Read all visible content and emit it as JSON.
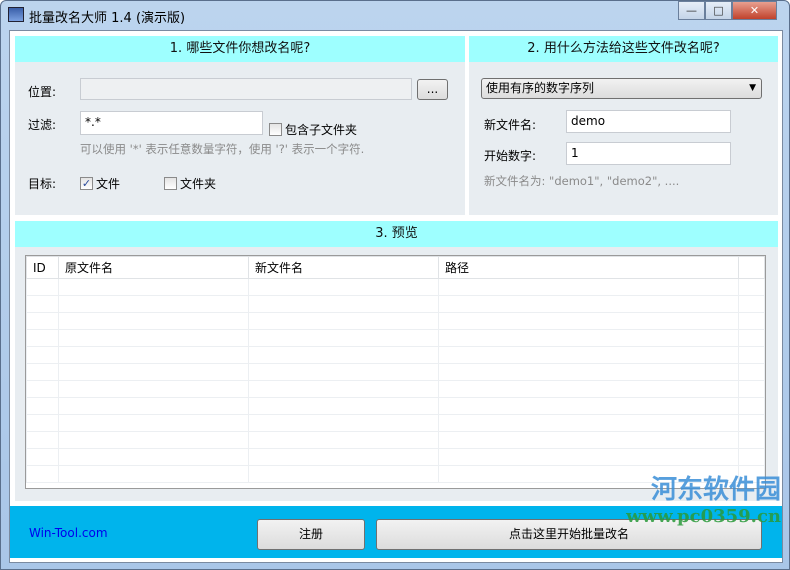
{
  "window": {
    "title": "批量改名大师 1.4 (演示版)",
    "minimize": "—",
    "maximize": "□",
    "close": "✕"
  },
  "section1": {
    "header": "1. 哪些文件你想改名呢?",
    "location_label": "位置:",
    "location_value": "",
    "browse_label": "...",
    "filter_label": "过滤:",
    "filter_value": "*.*",
    "include_subfolders": "包含子文件夹",
    "hint": "可以使用 '*' 表示任意数量字符，使用 '?' 表示一个字符.",
    "target_label": "目标:",
    "target_files": "文件",
    "target_folders": "文件夹"
  },
  "section2": {
    "header": "2. 用什么方法给这些文件改名呢?",
    "method": "使用有序的数字序列",
    "newname_label": "新文件名:",
    "newname_value": "demo",
    "start_label": "开始数字:",
    "start_value": "1",
    "preview_hint": "新文件名为:  \"demo1\", \"demo2\", ...."
  },
  "section3": {
    "header": "3. 预览",
    "columns": [
      "ID",
      "原文件名",
      "新文件名",
      "路径"
    ]
  },
  "footer": {
    "link": "Win-Tool.com",
    "register": "注册",
    "start": "点击这里开始批量改名"
  },
  "watermark": {
    "name": "河东软件园",
    "url": "www.pc0359.cn"
  }
}
